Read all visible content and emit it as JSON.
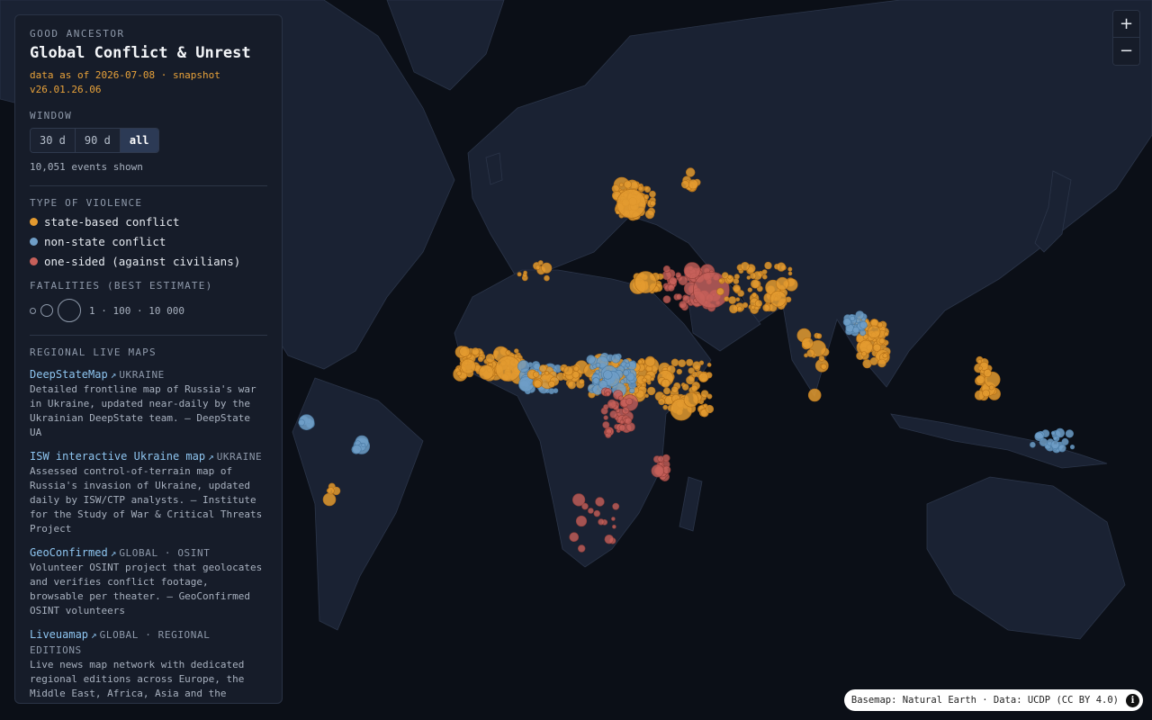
{
  "brand": "GOOD ANCESTOR",
  "title": "Global Conflict & Unrest",
  "meta": "data as of 2026-07-08 · snapshot v26.01.26.06",
  "window": {
    "label": "WINDOW",
    "options": [
      "30 d",
      "90 d",
      "all"
    ],
    "selected": "all",
    "count": "10,051 events shown"
  },
  "violence": {
    "label": "TYPE OF VIOLENCE",
    "items": [
      {
        "label": "state-based conflict",
        "color": "#e39a2f"
      },
      {
        "label": "non-state conflict",
        "color": "#6f9ec7"
      },
      {
        "label": "one-sided (against civilians)",
        "color": "#c7605a"
      }
    ]
  },
  "fatalities": {
    "label": "FATALITIES (BEST ESTIMATE)",
    "scale_text": "1 · 100 · 10 000"
  },
  "regional": {
    "label": "REGIONAL LIVE MAPS",
    "links": [
      {
        "name": "DeepStateMap",
        "tag": "UKRAINE",
        "desc": "Detailed frontline map of Russia's war in Ukraine, updated near-daily by the Ukrainian DeepState team. — DeepState UA"
      },
      {
        "name": "ISW interactive Ukraine map",
        "tag": "UKRAINE",
        "desc": "Assessed control-of-terrain map of Russia's invasion of Ukraine, updated daily by ISW/CTP analysts. — Institute for the Study of War & Critical Threats Project"
      },
      {
        "name": "GeoConfirmed",
        "tag": "GLOBAL · OSINT",
        "desc": "Volunteer OSINT project that geolocates and verifies conflict footage, browsable per theater. — GeoConfirmed OSINT volunteers"
      },
      {
        "name": "Liveuamap",
        "tag": "GLOBAL · REGIONAL EDITIONS",
        "desc": "Live news map network with dedicated regional editions across Europe, the Middle East, Africa, Asia and the Americas. — Live Universal Awareness Map"
      }
    ]
  },
  "zoom": {
    "in": "+",
    "out": "−"
  },
  "attribution": "Basemap: Natural Earth · Data: UCDP (CC BY 4.0)",
  "info_icon": "i",
  "colors": {
    "background": "#0b0f17",
    "land": "#1a2233",
    "panel": "#161c29",
    "accent": "#e8a23a",
    "link": "#8ec5f0"
  }
}
